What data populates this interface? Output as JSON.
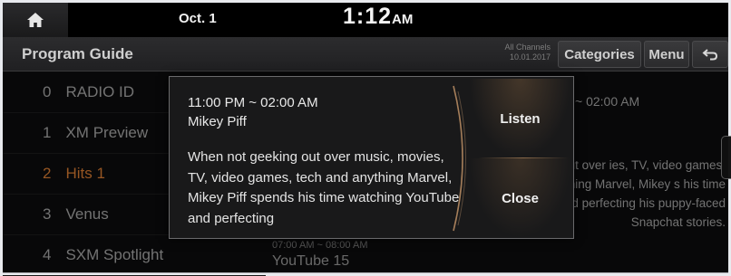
{
  "status_bar": {
    "date": "Oct. 1",
    "time": "1:12",
    "ampm": "AM",
    "home_icon": "home-icon"
  },
  "header": {
    "title": "Program Guide",
    "all_channels_line1": "All Channels",
    "all_channels_line2": "10.01.2017",
    "categories_label": "Categories",
    "menu_label": "Menu",
    "back_icon": "back-arrow-icon"
  },
  "channels": [
    {
      "num": "0",
      "name": "RADIO ID"
    },
    {
      "num": "1",
      "name": "XM Preview"
    },
    {
      "num": "2",
      "name": "Hits 1"
    },
    {
      "num": "3",
      "name": "Venus"
    },
    {
      "num": "4",
      "name": "SXM Spotlight"
    }
  ],
  "middle": {
    "time": "07:00 AM ~ 08:00 AM",
    "title": "YouTube 15"
  },
  "detail": {
    "time": "~ 02:00 AM",
    "description": "geeking out over ies, TV, video games, nything Marvel, Mikey s his time watching nd perfecting his puppy-faced Snapchat stories."
  },
  "popup": {
    "time": "11:00 PM ~ 02:00 AM",
    "name": "Mikey Piff",
    "description": "When not geeking out over music, movies, TV, video games, tech and anything Marvel, Mikey Piff spends his time watching YouTube and perfecting",
    "listen_label": "Listen",
    "close_label": "Close"
  },
  "colors": {
    "accent": "#c9732f",
    "background": "#0b0b0c"
  }
}
